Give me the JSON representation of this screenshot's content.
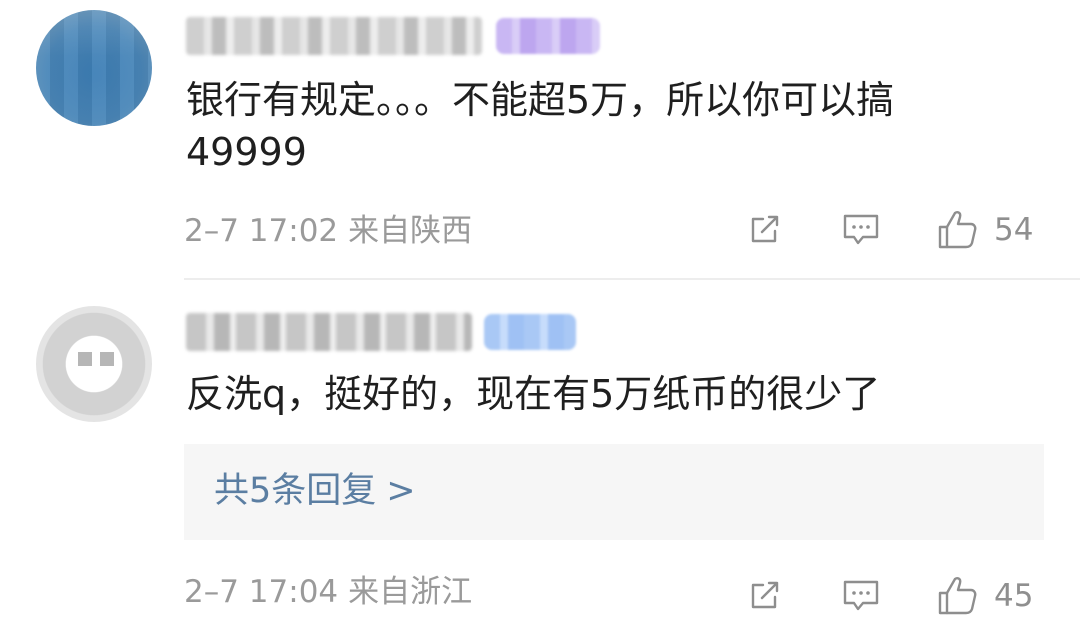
{
  "comments": [
    {
      "text_lines": [
        "银行有规定。。。不能超5万，所以你可以搞",
        "49999"
      ],
      "time": "2–7 17:02",
      "location": "来自陕西",
      "like_count": "54",
      "avatar_icon": "blurred-profile-avatar"
    },
    {
      "text_lines": [
        "反洗q，挺好的，现在有5万纸币的很少了"
      ],
      "replies_label": "共5条回复",
      "replies_arrow": ">",
      "time": "2–7 17:04",
      "location": "来自浙江",
      "like_count": "45",
      "avatar_icon": "placeholder-avatar"
    }
  ],
  "icons": {
    "share": "share-icon",
    "comment": "comment-icon",
    "like": "thumbs-up-icon"
  },
  "colors": {
    "reply_link": "#5b7ea2",
    "meta_text": "#9a9a9a",
    "reply_bg": "#f6f6f6"
  }
}
